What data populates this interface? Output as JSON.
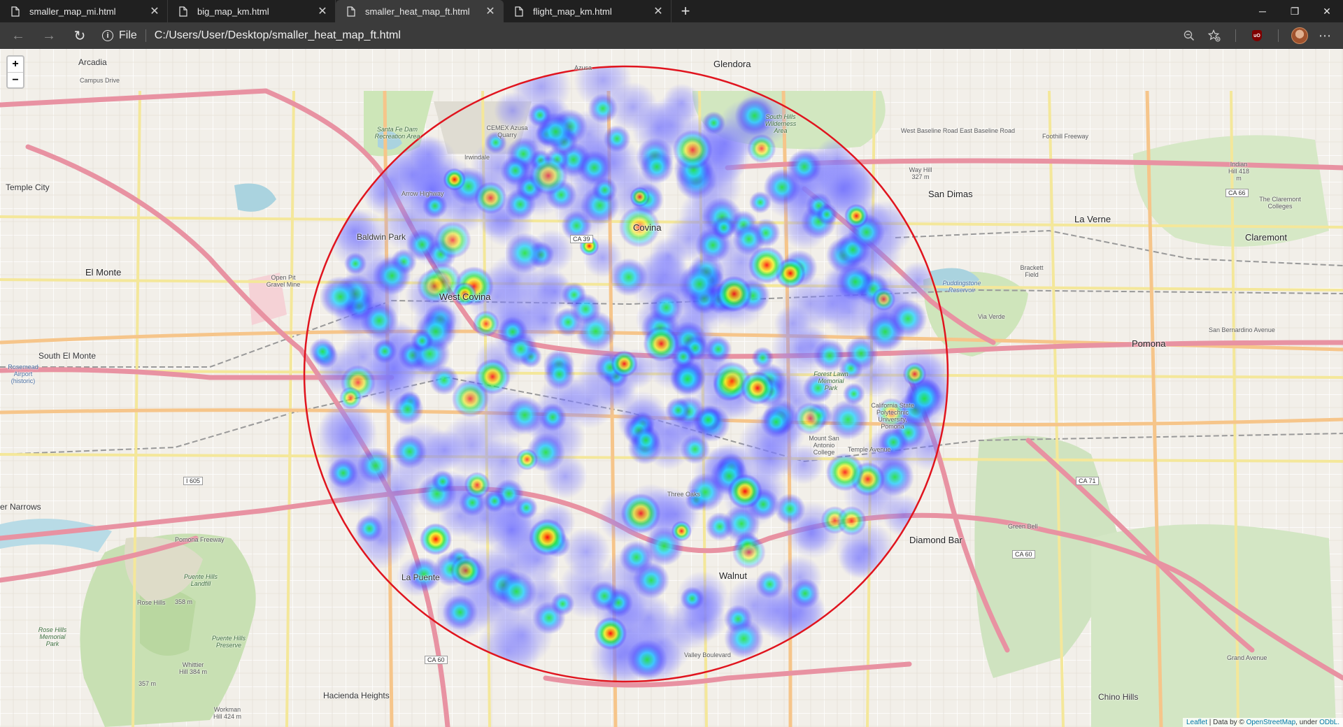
{
  "tabs": [
    {
      "label": "smaller_map_mi.html",
      "active": false
    },
    {
      "label": "big_map_km.html",
      "active": false
    },
    {
      "label": "smaller_heat_map_ft.html",
      "active": true
    },
    {
      "label": "flight_map_km.html",
      "active": false
    }
  ],
  "toolbar": {
    "file_label": "File",
    "url": "C:/Users/User/Desktop/smaller_heat_map_ft.html"
  },
  "icons": {
    "back": "back-arrow-icon",
    "forward": "forward-arrow-icon",
    "refresh": "refresh-icon",
    "info": "info-icon",
    "zoom_out": "zoom-out-icon",
    "favorites": "favorites-star-icon",
    "extension": "ublock-icon",
    "profile": "avatar",
    "menu": "more-icon"
  },
  "map": {
    "zoom_in": "+",
    "zoom_out": "−",
    "attribution": {
      "leaflet": "Leaflet",
      "text": " | Data by © ",
      "osm": "OpenStreetMap",
      "suffix": ", under ",
      "odbl": "ODbL."
    },
    "places": {
      "glendora": "Glendora",
      "arcadia": "Arcadia",
      "temple_city": "Temple City",
      "el_monte": "El Monte",
      "south_el_monte": "South El Monte",
      "baldwin_park": "Baldwin Park",
      "covina": "Covina",
      "west_covina": "West Covina",
      "irwindale": "Irwindale",
      "san_dimas": "San Dimas",
      "la_verne": "La Verne",
      "claremont": "Claremont",
      "pomona": "Pomona",
      "diamond_bar": "Diamond Bar",
      "walnut": "Walnut",
      "la_puente": "La Puente",
      "hacienda_heights": "Hacienda Heights",
      "chino_hills": "Chino Hills",
      "rose_hills": "Rose Hills",
      "azusa": "Azusa",
      "santa_fe": "Santa Fe Dam Recreation Area",
      "open_pit": "Open Pit Gravel Mine",
      "cemex": "CEMEX Azusa Quarry",
      "south_hills": "South Hills Wilderness Area",
      "way_hill": "Way Hill 327 m",
      "indian_hill": "Indian Hill 418 m",
      "puddingstone": "Puddingstone Reservoir",
      "brackett": "Brackett Field",
      "mt_sac": "Mount San Antonio College",
      "cal_poly": "California State Polytechnic University, Pomona",
      "forest_lawn": "Forest Lawn Memorial Park",
      "puente_hills_landfill": "Puente Hills Landfill",
      "puente_hills_preserve": "Puente Hills Preserve",
      "rose_hills_park": "Rose Hills Memorial Park",
      "whittier_hill": "Whittier Hill 384 m",
      "workman_hill": "Workman Hill 424 m",
      "peak_357": "357 m",
      "peak_358": "358 m",
      "rosemead_airport": "Rosemead Airport (historic)",
      "dollar_narrows": "er Narrows",
      "claremont_college": "The Claremont Colleges",
      "three_oaks": "Three Oaks",
      "green_bell": "Green Bell"
    },
    "roads": {
      "i605": "I 605",
      "ca60": "CA 60",
      "ca60_b": "CA 60",
      "ca71": "CA 71",
      "ca66": "CA 66",
      "ca39": "CA 39",
      "foothill": "Foothill Freeway",
      "baseline": "West Baseline Road",
      "east_baseline": "East Baseline Road",
      "pomona_fwy": "Pomona Freeway",
      "valley_blvd": "Valley Boulevard",
      "arrow_hwy": "Arrow Highway",
      "sb_ave": "San Bernardino Avenue",
      "grand_ave": "Grand Avenue",
      "via_verde": "Via Verde",
      "temple_ave": "Temple Avenue",
      "campus_drive": "Campus Drive"
    }
  },
  "heatmap": {
    "circle_color": "#e0141e",
    "gradient": [
      "#3b3bff",
      "#29d3ff",
      "#22e23a",
      "#f4f41a",
      "#ff8c00",
      "#ff0000"
    ]
  },
  "colors": {
    "motorway": "#e892a2",
    "primary": "#fcd6a4",
    "secondary": "#f7fabf",
    "park": "#c8e0b3",
    "water": "#aad3df",
    "landfill": "#d0d0bc"
  }
}
